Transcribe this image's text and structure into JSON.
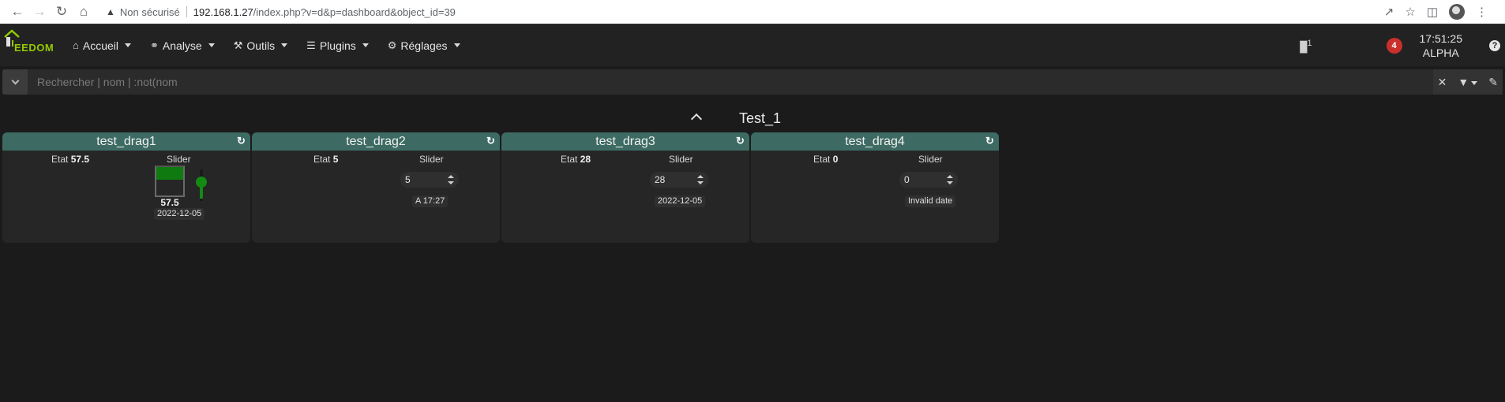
{
  "browser": {
    "security_label": "Non sécurisé",
    "url_host": "192.168.1.27",
    "url_path": "/index.php?v=d&p=dashboard&object_id=39"
  },
  "navbar": {
    "logo_text": "EEDOM",
    "menus": [
      {
        "label": "Accueil",
        "icon": "home-icon"
      },
      {
        "label": "Analyse",
        "icon": "stethoscope-icon"
      },
      {
        "label": "Outils",
        "icon": "wrench-icon"
      },
      {
        "label": "Plugins",
        "icon": "list-icon"
      },
      {
        "label": "Réglages",
        "icon": "gear-icon"
      }
    ],
    "door_count": "1",
    "notification_count": "4",
    "time": "17:51:25",
    "user": "ALPHA"
  },
  "search": {
    "placeholder": "Rechercher | nom | :not(nom"
  },
  "object": {
    "title": "Test_1"
  },
  "colors": {
    "accent_green": "#94ca02",
    "widget_header": "#3d6b63",
    "slider_green": "#138b13",
    "badge_red": "#c9302c"
  },
  "widgets": [
    {
      "title": "test_drag1",
      "etat_label": "Etat",
      "etat_value": "57.5",
      "slider_label": "Slider",
      "slider_value": "57.5",
      "slider_level": 0.4,
      "date": "2022-12-05"
    },
    {
      "title": "test_drag2",
      "etat_label": "Etat",
      "etat_value": "5",
      "slider_label": "Slider",
      "slider_value": "5",
      "date": "A 17:27"
    },
    {
      "title": "test_drag3",
      "etat_label": "Etat",
      "etat_value": "28",
      "slider_label": "Slider",
      "slider_value": "28",
      "date": "2022-12-05"
    },
    {
      "title": "test_drag4",
      "etat_label": "Etat",
      "etat_value": "0",
      "slider_label": "Slider",
      "slider_value": "0",
      "date": "Invalid date"
    }
  ]
}
